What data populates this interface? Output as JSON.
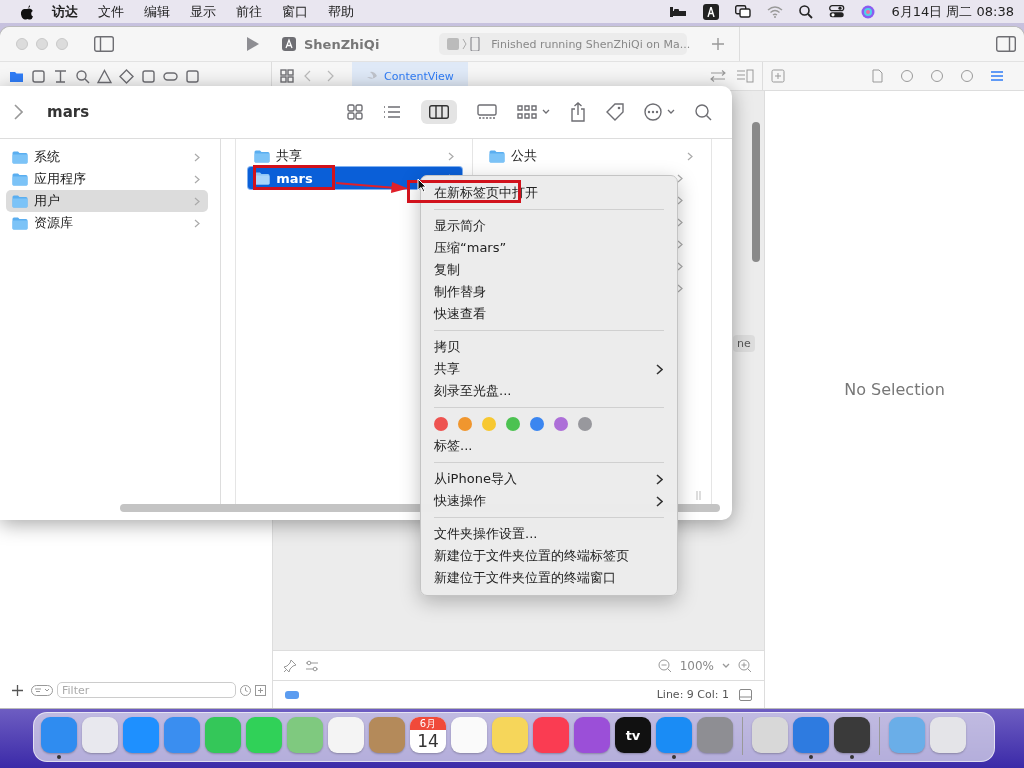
{
  "menubar": {
    "app_name": "访达",
    "menus": [
      "文件",
      "编辑",
      "显示",
      "前往",
      "窗口",
      "帮助"
    ],
    "clock": "6月14日 周二  08:38"
  },
  "xcode": {
    "scheme": "ShenZhiQi",
    "status": "Finished running ShenZhiQi on Ma...",
    "editor_tab": "ContentView",
    "inspector_message": "No Selection",
    "zoom": "100%",
    "cursor_position": "Line: 9  Col: 1",
    "filter_placeholder": "Filter",
    "fragment": "ne"
  },
  "finder": {
    "title": "mars",
    "sidebar": [
      {
        "label": "系统",
        "selected": false
      },
      {
        "label": "应用程序",
        "selected": false
      },
      {
        "label": "用户",
        "selected": true
      },
      {
        "label": "资源库",
        "selected": false
      }
    ],
    "columns": [
      [
        {
          "label": "共享",
          "selected": false
        },
        {
          "label": "mars",
          "selected": true
        }
      ],
      [
        {
          "label": "公共",
          "selected": false
        }
      ]
    ]
  },
  "context_menu": {
    "items": [
      {
        "kind": "item",
        "label": "在新标签页中打开",
        "submenu": false
      },
      {
        "kind": "separator"
      },
      {
        "kind": "item",
        "label": "显示简介",
        "submenu": false
      },
      {
        "kind": "item",
        "label": "压缩“mars”",
        "submenu": false
      },
      {
        "kind": "item",
        "label": "复制",
        "submenu": false
      },
      {
        "kind": "item",
        "label": "制作替身",
        "submenu": false
      },
      {
        "kind": "item",
        "label": "快速查看",
        "submenu": false
      },
      {
        "kind": "separator"
      },
      {
        "kind": "item",
        "label": "拷贝",
        "submenu": false
      },
      {
        "kind": "item",
        "label": "共享",
        "submenu": true
      },
      {
        "kind": "item",
        "label": "刻录至光盘...",
        "submenu": false
      },
      {
        "kind": "separator"
      },
      {
        "kind": "tags",
        "colors": [
          {
            "color": "#ee5350"
          },
          {
            "color": "#f0962e"
          },
          {
            "color": "#f7c831"
          },
          {
            "color": "#4cc251"
          },
          {
            "color": "#3b86f0"
          },
          {
            "color": "#ad6fd8"
          },
          {
            "color": "#98989d"
          }
        ]
      },
      {
        "kind": "item",
        "label": "标签...",
        "submenu": false
      },
      {
        "kind": "separator"
      },
      {
        "kind": "item",
        "label": "从iPhone导入",
        "submenu": true
      },
      {
        "kind": "item",
        "label": "快速操作",
        "submenu": true
      },
      {
        "kind": "separator"
      },
      {
        "kind": "item",
        "label": "文件夹操作设置...",
        "submenu": false
      },
      {
        "kind": "item",
        "label": "新建位于文件夹位置的终端标签页",
        "submenu": false
      },
      {
        "kind": "item",
        "label": "新建位于文件夹位置的终端窗口",
        "submenu": false
      }
    ]
  },
  "dock": {
    "items": [
      {
        "kind": "app",
        "color": "#2f8cf0",
        "running": true
      },
      {
        "kind": "app",
        "color": "#e8e8ee",
        "running": false
      },
      {
        "kind": "app",
        "color": "#1e90ff",
        "running": false
      },
      {
        "kind": "app",
        "color": "#3a8ef0",
        "running": false
      },
      {
        "kind": "app",
        "color": "#34c759",
        "running": false
      },
      {
        "kind": "app",
        "color": "#30d158",
        "running": false
      },
      {
        "kind": "app",
        "color": "#7fc97f",
        "running": false
      },
      {
        "kind": "app",
        "color": "#f4f4f4",
        "running": false
      },
      {
        "kind": "app",
        "color": "#b48a5a",
        "running": false
      },
      {
        "kind": "calendar",
        "month": "6月",
        "day": "14",
        "running": false
      },
      {
        "kind": "app",
        "color": "#fafafa",
        "running": false
      },
      {
        "kind": "app",
        "color": "#f6d65a",
        "running": false
      },
      {
        "kind": "app",
        "color": "#fa3c52",
        "running": false
      },
      {
        "kind": "app",
        "color": "#9b4fd8",
        "running": false
      },
      {
        "kind": "tv",
        "label": "tv",
        "running": false
      },
      {
        "kind": "app",
        "color": "#1a8cf5",
        "running": true
      },
      {
        "kind": "app",
        "color": "#8e8e93",
        "running": false
      },
      {
        "kind": "divider"
      },
      {
        "kind": "app",
        "color": "#d8d8d8",
        "running": false
      },
      {
        "kind": "app",
        "color": "#2e7be0",
        "running": true
      },
      {
        "kind": "app",
        "color": "#3a3a3a",
        "running": true
      },
      {
        "kind": "divider"
      },
      {
        "kind": "app",
        "color": "#6aaee8",
        "running": false
      },
      {
        "kind": "app",
        "color": "#e4e4e8",
        "running": false
      }
    ]
  }
}
